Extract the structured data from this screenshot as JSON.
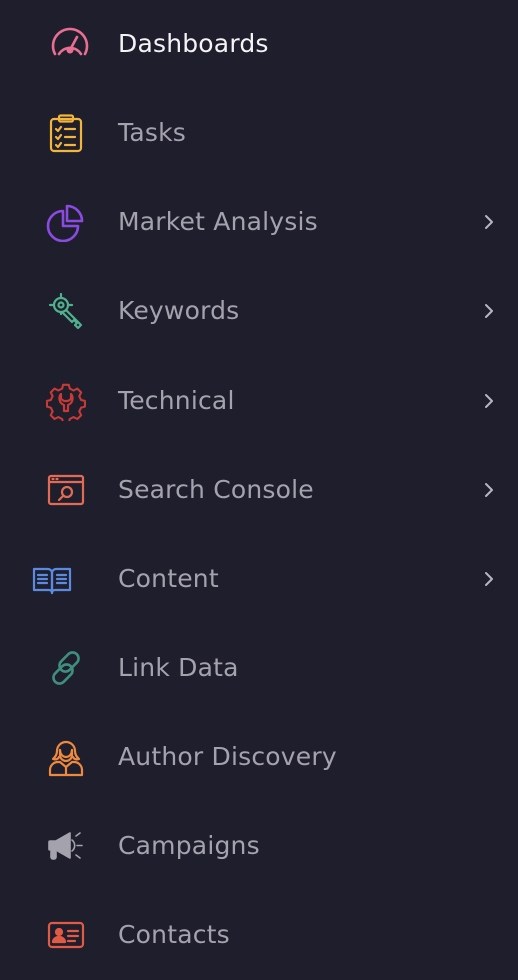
{
  "sidebar": {
    "items": [
      {
        "label": "Dashboards",
        "icon": "speedometer-icon",
        "color": "#e86f91",
        "active": true,
        "has_submenu": false
      },
      {
        "label": "Tasks",
        "icon": "clipboard-checklist-icon",
        "color": "#f2b63a",
        "active": false,
        "has_submenu": false
      },
      {
        "label": "Market Analysis",
        "icon": "pie-chart-icon",
        "color": "#8a4be0",
        "active": false,
        "has_submenu": true
      },
      {
        "label": "Keywords",
        "icon": "key-target-icon",
        "color": "#4fb28c",
        "active": false,
        "has_submenu": true
      },
      {
        "label": "Technical",
        "icon": "gear-wrench-icon",
        "color": "#c73a35",
        "active": false,
        "has_submenu": true
      },
      {
        "label": "Search Console",
        "icon": "browser-search-icon",
        "color": "#e36b55",
        "active": false,
        "has_submenu": true
      },
      {
        "label": "Content",
        "icon": "open-book-icon",
        "color": "#5a8be0",
        "active": false,
        "has_submenu": true
      },
      {
        "label": "Link Data",
        "icon": "chain-link-icon",
        "color": "#3f8f7e",
        "active": false,
        "has_submenu": false
      },
      {
        "label": "Author Discovery",
        "icon": "author-portrait-icon",
        "color": "#ee8a3d",
        "active": false,
        "has_submenu": false
      },
      {
        "label": "Campaigns",
        "icon": "megaphone-icon",
        "color": "#a4a3ad",
        "active": false,
        "has_submenu": false
      },
      {
        "label": "Contacts",
        "icon": "contact-card-icon",
        "color": "#e05a44",
        "active": false,
        "has_submenu": false
      }
    ]
  },
  "colors": {
    "background": "#1f1e2d",
    "label": "#a4a3ad",
    "label_active": "#f4f4f6",
    "chevron": "#b8b7c0"
  }
}
